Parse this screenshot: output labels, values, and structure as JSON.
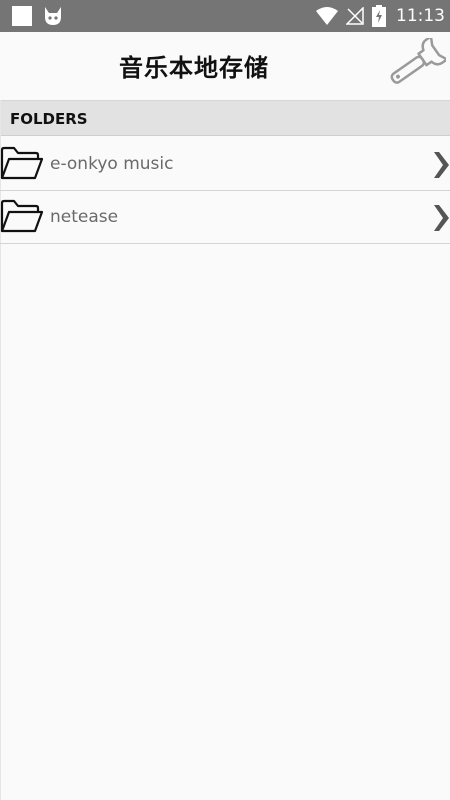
{
  "status_bar": {
    "time": "11:13",
    "icons": [
      "square-notification-icon",
      "cat-app-icon",
      "wifi-icon",
      "no-signal-icon",
      "battery-charging-icon"
    ]
  },
  "header": {
    "title": "音乐本地存储",
    "settings_icon": "wrench-icon"
  },
  "section": {
    "label": "FOLDERS"
  },
  "folders": [
    {
      "label": "e-onkyo music",
      "icon": "folder-open-icon",
      "chevron": "chevron-right-icon"
    },
    {
      "label": "netease",
      "icon": "folder-open-icon",
      "chevron": "chevron-right-icon"
    }
  ],
  "colors": {
    "status_bar": "#757575",
    "background": "#fafafa",
    "section_header": "#e2e2e2",
    "folder_text": "#6a6a6a",
    "title_text": "#111111"
  }
}
